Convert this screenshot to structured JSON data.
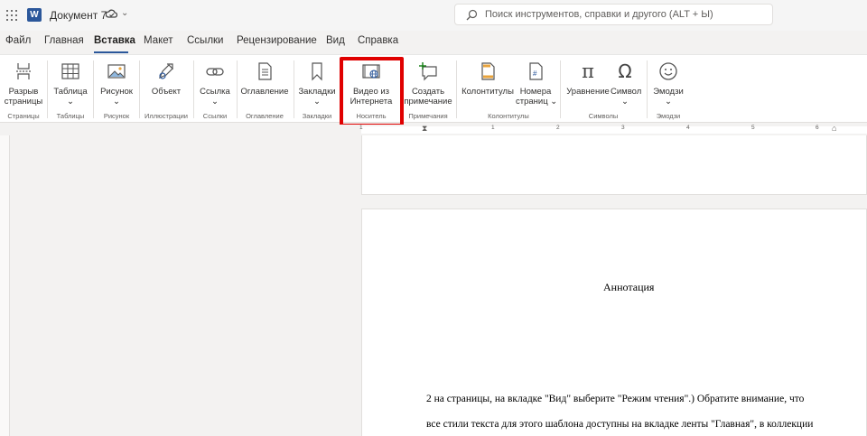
{
  "titlebar": {
    "doc_title": "Документ 7",
    "search_placeholder": "Поиск инструментов, справки и другого (ALT + Ы)"
  },
  "menu": {
    "tabs": [
      "Файл",
      "Главная",
      "Вставка",
      "Макет",
      "Ссылки",
      "Рецензирование",
      "Вид",
      "Справка"
    ],
    "active": "Вставка"
  },
  "ribbon": {
    "buttons": [
      {
        "line1": "Разрыв",
        "line2": "страницы"
      },
      {
        "line1": "Таблица",
        "line2": "⌄"
      },
      {
        "line1": "Рисунок",
        "line2": "⌄"
      },
      {
        "line1": "Объект",
        "line2": ""
      },
      {
        "line1": "Ссылка",
        "line2": "⌄"
      },
      {
        "line1": "Оглавление",
        "line2": ""
      },
      {
        "line1": "Закладки",
        "line2": "⌄"
      },
      {
        "line1": "Видео из",
        "line2": "Интернета"
      },
      {
        "line1": "Создать",
        "line2": "примечание"
      },
      {
        "line1": "Колонтитулы",
        "line2": ""
      },
      {
        "line1": "Номера",
        "line2": "страниц ⌄"
      },
      {
        "line1": "Уравнение",
        "line2": ""
      },
      {
        "line1": "Символ",
        "line2": "⌄"
      },
      {
        "line1": "Эмодзи",
        "line2": "⌄"
      }
    ],
    "groups": [
      "Страницы",
      "Таблицы",
      "Рисунок",
      "Иллюстрации",
      "Ссылки",
      "Оглавление",
      "Закладки",
      "Носитель",
      "Примечания",
      "Колонтитулы",
      "Символы",
      "Эмодзи"
    ]
  },
  "ruler": {
    "numbers": [
      "1",
      "1",
      "2",
      "3",
      "4",
      "5",
      "6"
    ]
  },
  "document": {
    "heading": "Аннотация",
    "line1": "2 на страницы, на вкладке \"Вид\" выберите \"Режим чтения\".) Обратите внимание, что",
    "line2": "все стили текста для этого шаблона доступны на вкладке ленты \"Главная\", в коллекции"
  },
  "colors": {
    "accent": "#2b579a",
    "highlight": "#e00000"
  }
}
